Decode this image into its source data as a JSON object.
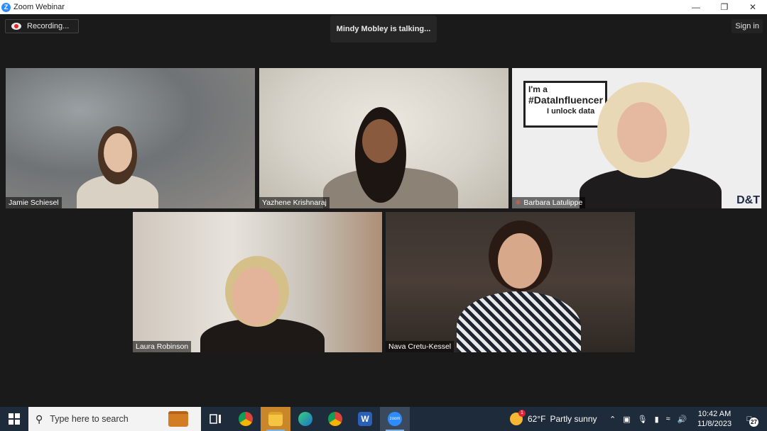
{
  "window": {
    "title": "Zoom Webinar",
    "logo_letter": "Z"
  },
  "meeting": {
    "recording_label": "Recording...",
    "talking_label": "Mindy Mobley is talking...",
    "signin_label": "Sign in"
  },
  "participants": [
    {
      "name": "Jamie Schiesel"
    },
    {
      "name": "Yazhene Krishnaraj"
    },
    {
      "name": "Barbara Latulippe",
      "muted_icon": "mic-muted-icon"
    },
    {
      "name": "Laura Robinson"
    },
    {
      "name": "Nava Cretu-Kessel"
    }
  ],
  "background_sign": {
    "line1": "I'm a",
    "line2": "#DataInfluencer",
    "line3": "I unlock data",
    "brand": "D&T"
  },
  "taskbar": {
    "search_placeholder": "Type here to search",
    "weather_temp": "62°F",
    "weather_desc": "Partly sunny",
    "time": "10:42 AM",
    "date": "11/8/2023",
    "notification_count": "27",
    "zoom_icon_label": "zoom",
    "apps": [
      "task-view-icon",
      "chrome-icon",
      "file-explorer-icon",
      "edge-icon",
      "chrome-profile-icon",
      "word-icon",
      "zoom-icon"
    ]
  },
  "colors": {
    "accent": "#2d8cff",
    "taskbar": "#1d2b3a",
    "background": "#1a1a1a",
    "recording": "#e02828"
  }
}
